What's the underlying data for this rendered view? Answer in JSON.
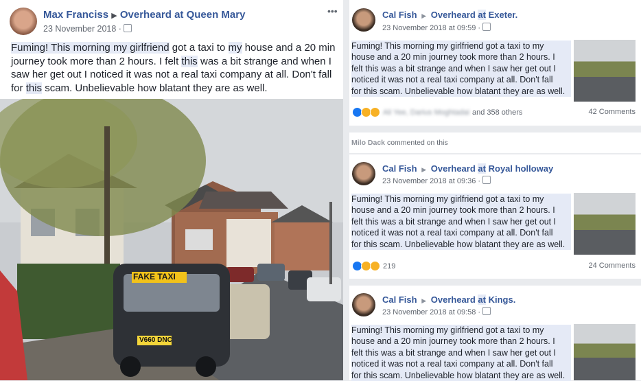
{
  "left": {
    "author": "Max Franciss",
    "group": "Overheard at Queen Mary",
    "date": "23 November 2018 ·",
    "menu": "•••",
    "text_parts": [
      "Fuming! This morning my girlfriend",
      " got a taxi to ",
      "my",
      " house and a 20 min journey took more than 2 hours. I felt ",
      "this",
      " was a bit strange and when I saw her get out I noticed it was not a real taxi company at all. Don't fall for ",
      "this",
      " scam. Unbelievable how blatant they are as well."
    ],
    "photo": {
      "taxi_sign": "FAKE TAXI",
      "plate": "V660 DNC"
    }
  },
  "shared_text": [
    "Fuming! This morning my girlfriend got a taxi to my",
    "house and a 20 min journey took more than 2 hours. I",
    "felt this was a bit strange and when I saw her get out I",
    "noticed it was not a real taxi company at all. Don't fall",
    "for this scam. Unbelievable how blatant they are as well."
  ],
  "right": {
    "posts": [
      {
        "author": "Cal Fish",
        "group_prefix": "Overheard",
        "group_at": "at",
        "group_name": "Exeter.",
        "date": "23 November 2018 at 09:59 ·",
        "reactions_names": "Ali Yee, Darius Moghtadai",
        "reactions_suffix": "and 358 others",
        "comments": "42 Comments"
      },
      {
        "author": "Cal Fish",
        "group_prefix": "Overheard",
        "group_at": "at",
        "group_name": "Royal holloway",
        "date": "23 November 2018 at 09:36 ·",
        "reactions_count": "219",
        "comments": "24 Comments"
      },
      {
        "author": "Cal Fish",
        "group_prefix": "Overheard",
        "group_at": "at",
        "group_name": "Kings.",
        "date": "23 November 2018 at 09:58 ·"
      }
    ],
    "activity": {
      "actor": "Milo Dack",
      "action": "commented on this"
    }
  },
  "colors": {
    "link": "#365899",
    "highlight": "#e5eaf6",
    "like": "#1877f2",
    "haha": "#f7b125"
  }
}
